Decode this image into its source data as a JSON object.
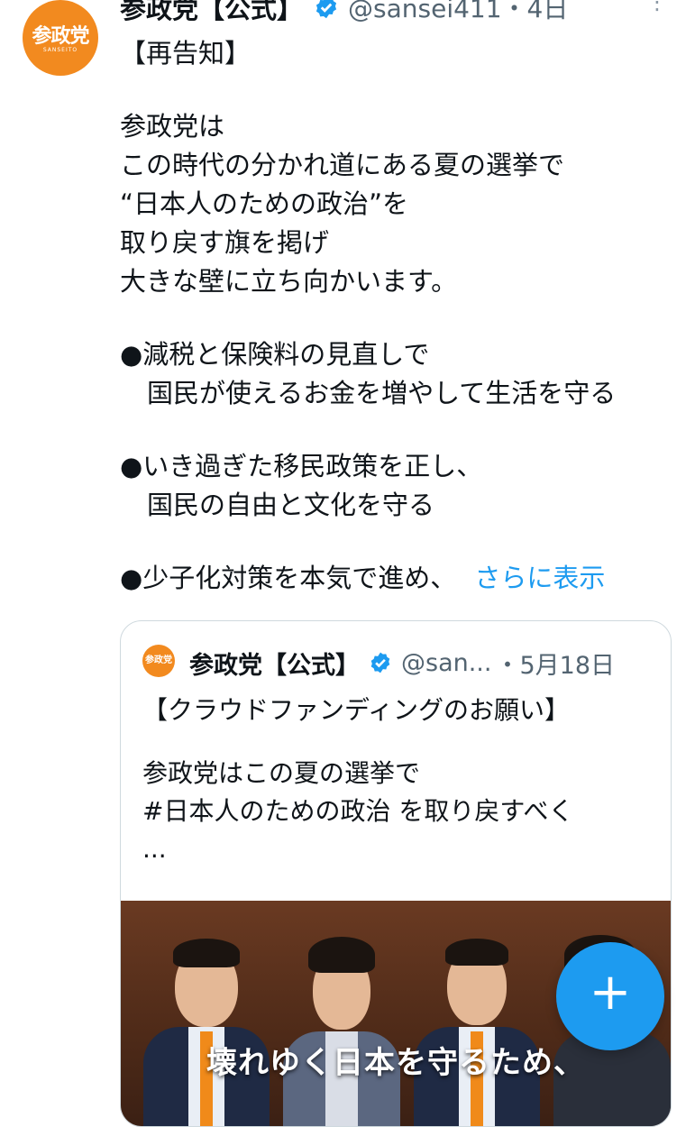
{
  "tweet": {
    "avatar_text": "参政党",
    "avatar_sub": "SANSEITO",
    "name": "参政党【公式】",
    "handle_time": "@sansei411・4日",
    "more_icon": "⋮",
    "lines": [
      "【再告知】",
      "",
      "参政党は",
      "この時代の分かれ道にある夏の選挙で",
      "“日本人のための政治”を",
      "取り戻す旗を掲げ",
      "大きな壁に立ち向かいます。",
      "",
      "●減税と保険料の見直しで",
      "国民が使えるお金を増やして生活を守る",
      "",
      "●いき過ぎた移民政策を正し、",
      "国民の自由と文化を守る",
      "",
      "●少子化対策を本気で進め、"
    ],
    "show_more": "さらに表示"
  },
  "quote": {
    "avatar_text": "参政党",
    "name": "参政党【公式】",
    "handle": "@san...",
    "date": "・5月18日",
    "lines": [
      "【クラウドファンディングのお願い】",
      "",
      "参政党はこの夏の選挙で",
      "#日本人のための政治 を取り戻すべく",
      "..."
    ],
    "media_caption": "壊れゆく日本を守るため、"
  },
  "fab": {
    "label": "+"
  },
  "colors": {
    "accent": "#1d9bf0",
    "brand": "#f28a1f",
    "text": "#0f1419",
    "muted": "#536471"
  }
}
